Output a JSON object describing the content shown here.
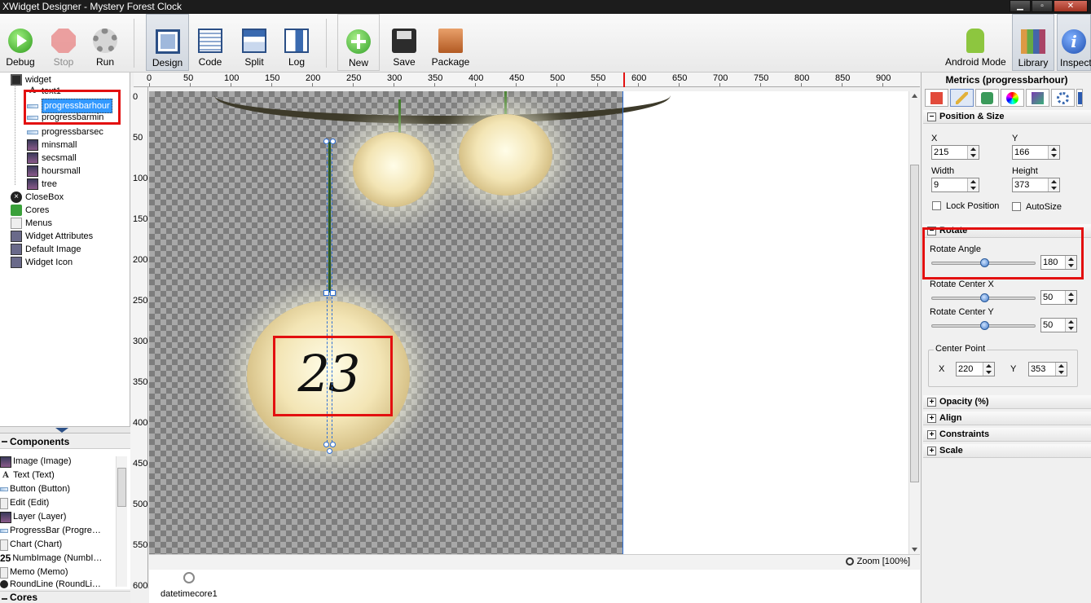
{
  "window": {
    "title": "XWidget Designer - Mystery Forest Clock",
    "minimize": "▁",
    "maximize": "▫",
    "close": "✕"
  },
  "toolbar": {
    "debug": "Debug",
    "stop": "Stop",
    "run": "Run",
    "design": "Design",
    "code": "Code",
    "split": "Split",
    "log": "Log",
    "new": "New",
    "save": "Save",
    "package": "Package",
    "android_mode": "Android Mode",
    "library": "Library",
    "inspector": "Inspecto"
  },
  "tree": {
    "root": "widget",
    "children": [
      "text1",
      "progressbarhour",
      "progressbarmin",
      "progressbarsec",
      "minsmall",
      "secsmall",
      "hoursmall",
      "tree"
    ],
    "other": [
      "CloseBox",
      "Cores",
      "Menus",
      "Widget Attributes",
      "Default Image",
      "Widget Icon"
    ]
  },
  "components": {
    "title": "Components",
    "items": [
      "Image (Image)",
      "Text (Text)",
      "Button (Button)",
      "Edit (Edit)",
      "Layer (Layer)",
      "ProgressBar (Progre…",
      "Chart (Chart)",
      "NumbImage (NumbI…",
      "Memo (Memo)",
      "RoundLine (RoundLi…"
    ],
    "numb_glyph": "25"
  },
  "cores_section": {
    "title": "Cores"
  },
  "ruler": {
    "h": [
      "0",
      "50",
      "100",
      "150",
      "200",
      "250",
      "300",
      "350",
      "400",
      "450",
      "500",
      "550",
      "600",
      "650",
      "700",
      "750",
      "800",
      "850",
      "900"
    ],
    "v": [
      "0",
      "50",
      "100",
      "150",
      "200",
      "250",
      "300",
      "350",
      "400",
      "450",
      "500",
      "550",
      "600"
    ]
  },
  "canvas": {
    "clock_digits": "23",
    "zoom": "Zoom [100%]",
    "core_label": "datetimecore1"
  },
  "inspector": {
    "title": "Metrics (progressbarhour)",
    "position_size": {
      "title": "Position & Size",
      "x_label": "X",
      "x": "215",
      "y_label": "Y",
      "y": "166",
      "width_label": "Width",
      "width": "9",
      "height_label": "Height",
      "height": "373",
      "lock_label": "Lock Position",
      "autosize_label": "AutoSize"
    },
    "rotate": {
      "title": "Rotate",
      "angle_label": "Rotate Angle",
      "angle": "180",
      "center_x_label": "Rotate Center X",
      "center_x": "50",
      "center_y_label": "Rotate Center Y",
      "center_y": "50",
      "center_point_label": "Center Point",
      "cp_x_label": "X",
      "cp_x": "220",
      "cp_y_label": "Y",
      "cp_y": "353"
    },
    "collapsed": [
      "Opacity (%)",
      "Align",
      "Constraints",
      "Scale"
    ]
  },
  "colors": {
    "highlight": "#e31010",
    "selection": "#3399ff",
    "accent": "#2d6fd6"
  }
}
